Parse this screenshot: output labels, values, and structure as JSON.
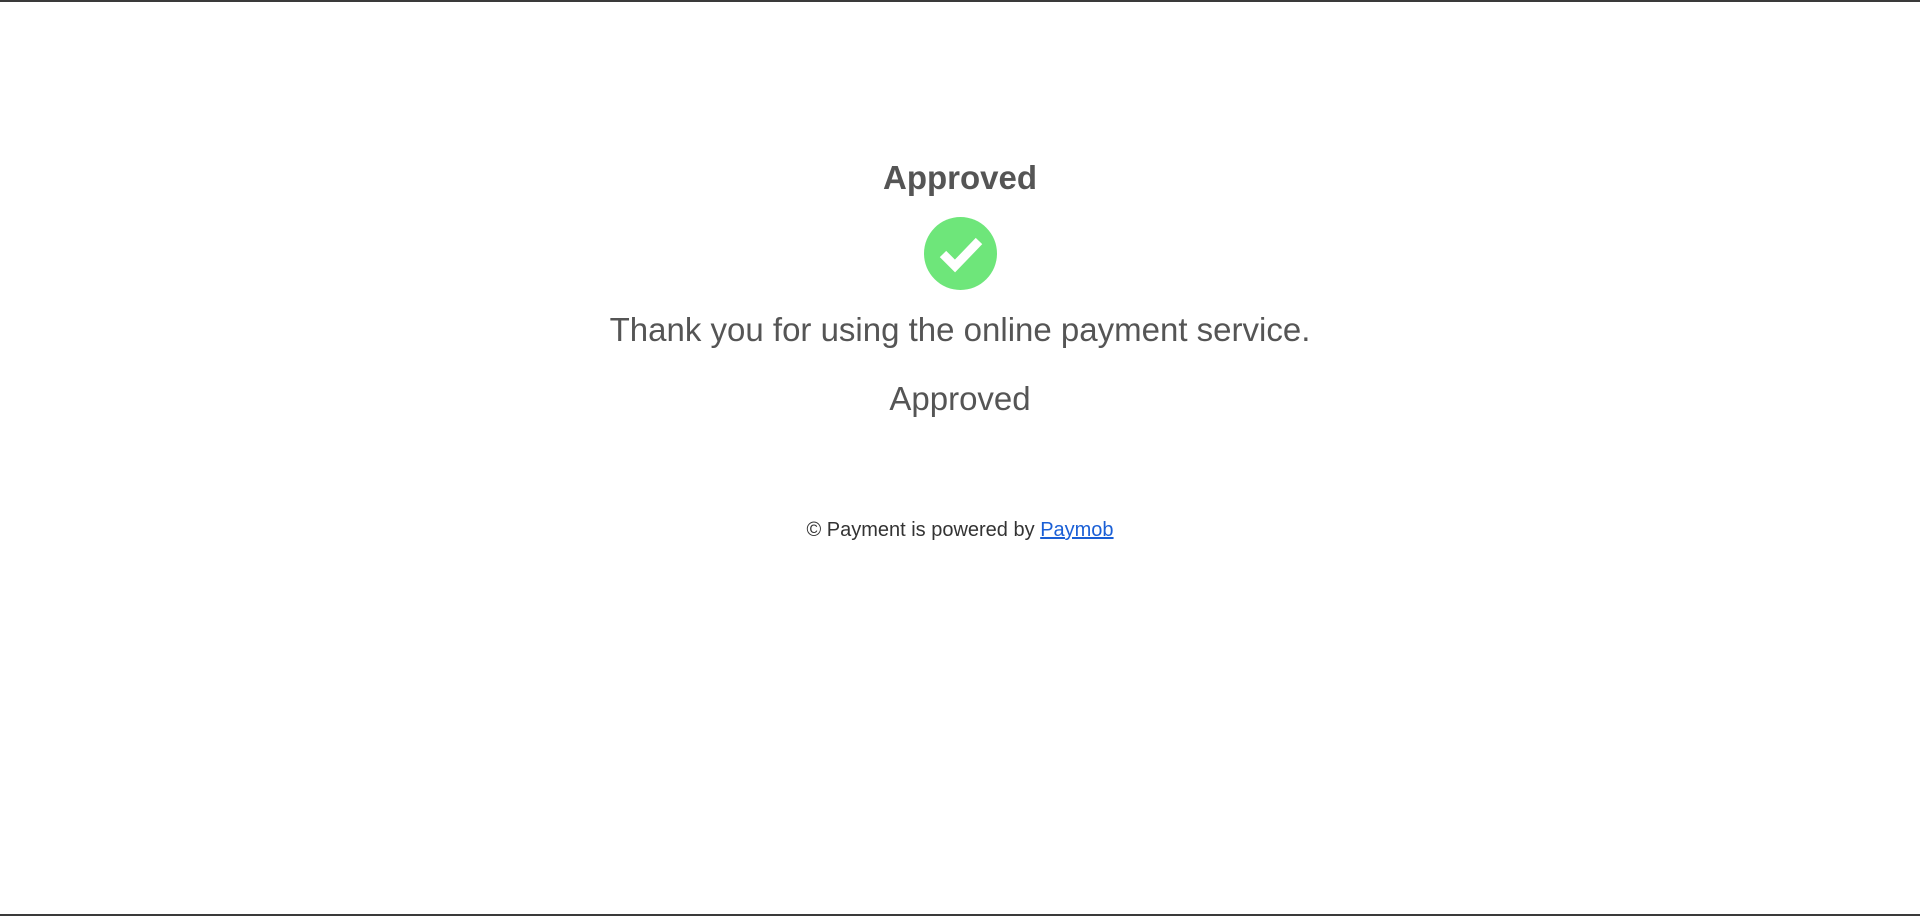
{
  "result": {
    "title": "Approved",
    "icon": "check-circle-icon",
    "icon_color": "#6ee67a",
    "message": "Thank you for using the online payment service.",
    "status": "Approved"
  },
  "footer": {
    "prefix": "© Payment is powered by",
    "link_text": "Paymob",
    "link_color": "#1a5fd6"
  }
}
